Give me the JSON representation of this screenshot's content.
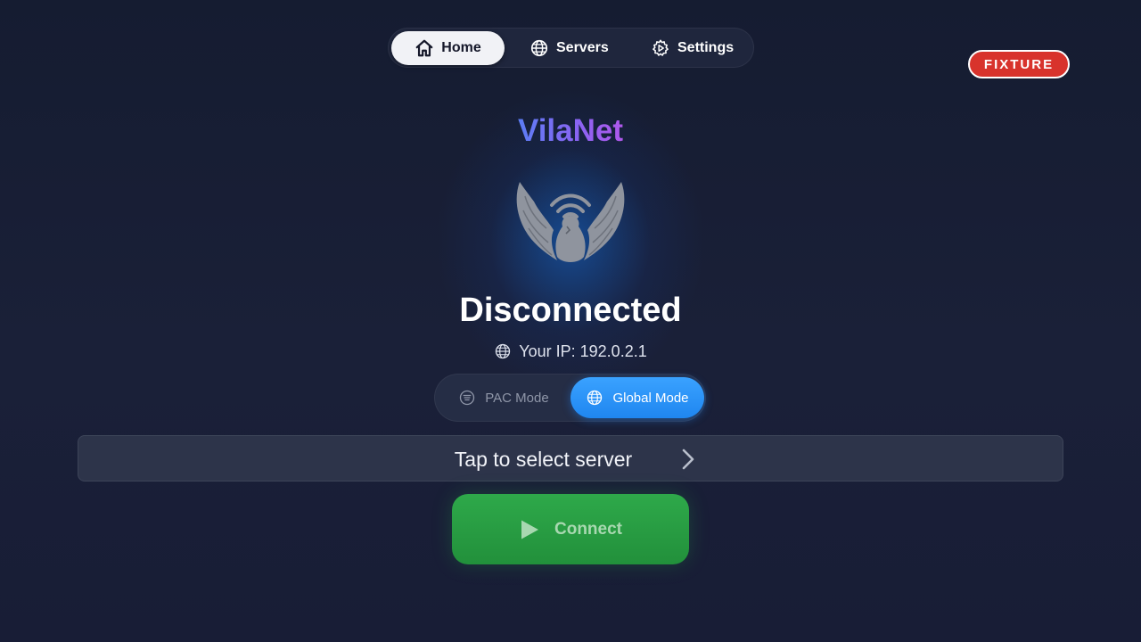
{
  "nav": {
    "items": [
      {
        "label": "Home",
        "icon": "home-icon",
        "active": true
      },
      {
        "label": "Servers",
        "icon": "globe-icon",
        "active": false
      },
      {
        "label": "Settings",
        "icon": "gear-icon",
        "active": false
      }
    ]
  },
  "badge": {
    "label": "FIXTURE",
    "color": "#d8332c"
  },
  "brand": {
    "name": "VilaNet",
    "gradient": [
      "#3f8cf6",
      "#8b63f2",
      "#cf4fe6"
    ]
  },
  "logo": {
    "icon": "winged-signal-logo"
  },
  "status": {
    "label": "Disconnected"
  },
  "ip": {
    "icon": "globe-icon",
    "text": "Your IP: 192.0.2.1"
  },
  "mode": {
    "options": [
      {
        "label": "PAC Mode",
        "icon": "list-circle-icon",
        "selected": false
      },
      {
        "label": "Global Mode",
        "icon": "globe-icon",
        "selected": true
      }
    ],
    "accent": "#1f86f0"
  },
  "server_select": {
    "label": "Tap to select server",
    "icon": "chevron-right-icon"
  },
  "connect": {
    "label": "Connect",
    "icon": "play-icon",
    "color": "#22903b"
  }
}
